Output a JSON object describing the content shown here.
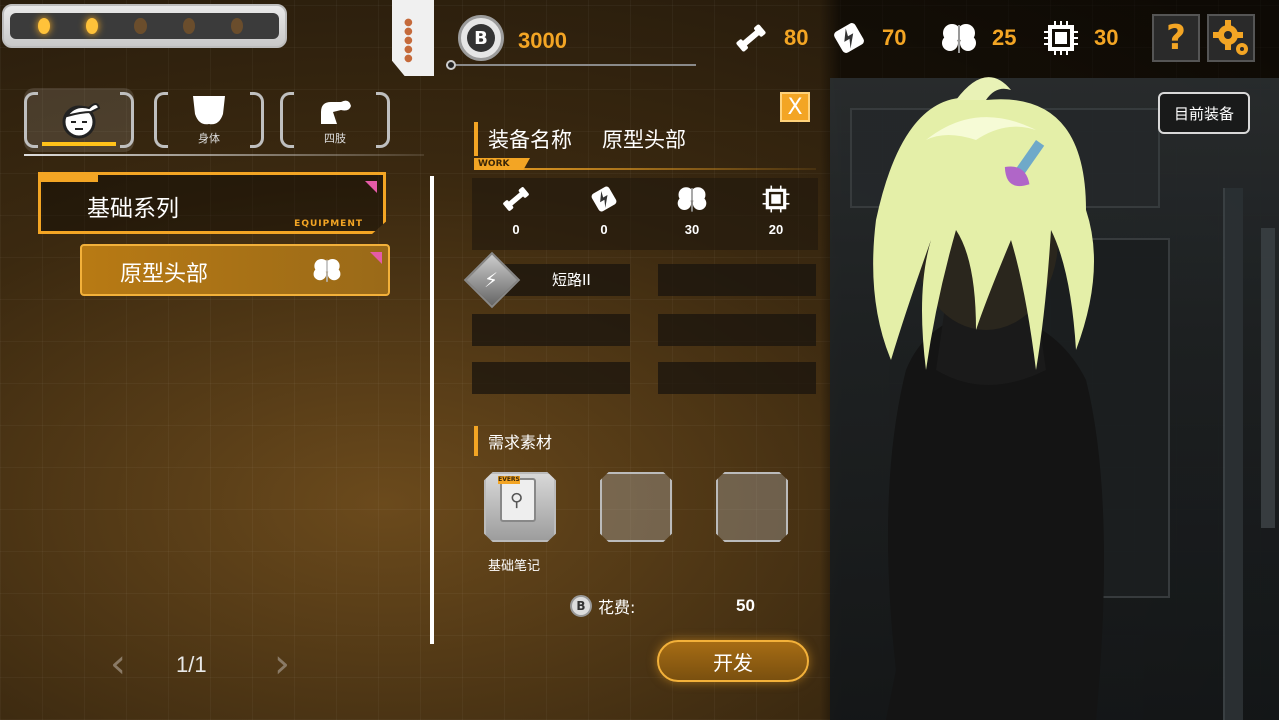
{
  "top": {
    "indicator_dots": [
      true,
      true,
      false,
      false,
      false
    ],
    "currency": {
      "icon": "b-coin-icon",
      "value": "3000"
    },
    "stats": [
      {
        "icon": "dumbbell-icon",
        "value": "80"
      },
      {
        "icon": "lightning-icon",
        "value": "70"
      },
      {
        "icon": "brain-icon",
        "value": "25"
      },
      {
        "icon": "chip-icon",
        "value": "30"
      }
    ],
    "help_label": "?",
    "gear_icon": "gear-icon"
  },
  "tabs": [
    {
      "icon": "head-icon",
      "label": "",
      "active": true
    },
    {
      "icon": "torso-icon",
      "label": "身体",
      "active": false
    },
    {
      "icon": "arm-icon",
      "label": "四肢",
      "active": false
    }
  ],
  "series": {
    "label": "基础系列",
    "sub": "EQUIPMENT"
  },
  "list": [
    {
      "label": "原型头部",
      "icon": "brain-icon"
    }
  ],
  "pager": {
    "text": "1/1",
    "prev": "‹",
    "next": "›"
  },
  "detail": {
    "close": "X",
    "title_label": "装备名称",
    "title_value": "原型头部",
    "work_tag": "WORK",
    "stats": [
      {
        "icon": "dumbbell-icon",
        "value": "0"
      },
      {
        "icon": "lightning-icon",
        "value": "0"
      },
      {
        "icon": "brain-icon",
        "value": "30"
      },
      {
        "icon": "chip-icon",
        "value": "20"
      }
    ],
    "skill": "短路II",
    "materials_title": "需求素材",
    "materials": [
      {
        "name": "基础笔记",
        "tag": "EVERS"
      }
    ],
    "cost_label": "花费:",
    "cost_value": "50",
    "develop": "开发"
  },
  "current_equip": "目前装备",
  "colors": {
    "accent": "#f3a524",
    "highlight": "#ffc21a",
    "corner": "#e55ba8"
  }
}
